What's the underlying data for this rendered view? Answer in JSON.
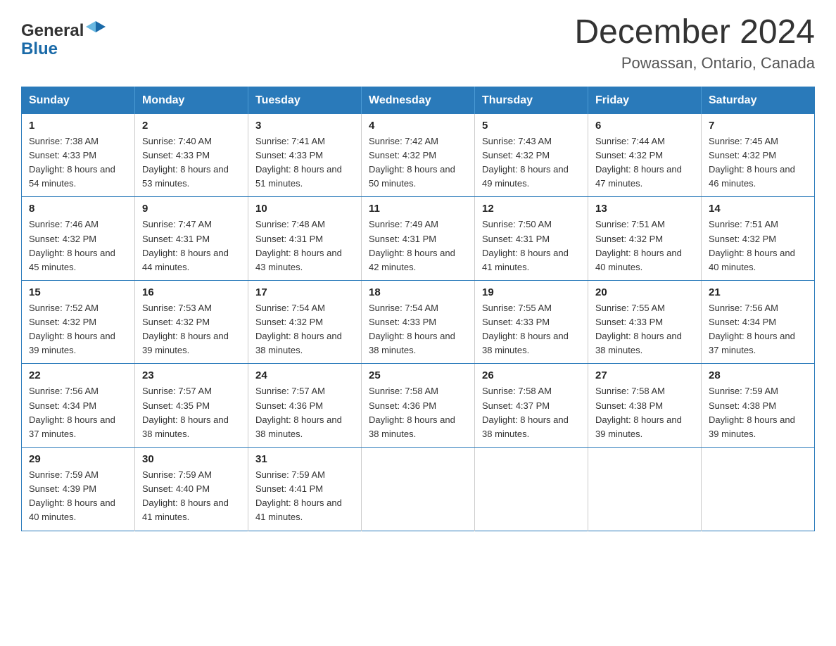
{
  "header": {
    "title": "December 2024",
    "subtitle": "Powassan, Ontario, Canada",
    "logo_general": "General",
    "logo_blue": "Blue"
  },
  "calendar": {
    "days_of_week": [
      "Sunday",
      "Monday",
      "Tuesday",
      "Wednesday",
      "Thursday",
      "Friday",
      "Saturday"
    ],
    "weeks": [
      [
        {
          "day": "1",
          "sunrise": "7:38 AM",
          "sunset": "4:33 PM",
          "daylight": "8 hours and 54 minutes."
        },
        {
          "day": "2",
          "sunrise": "7:40 AM",
          "sunset": "4:33 PM",
          "daylight": "8 hours and 53 minutes."
        },
        {
          "day": "3",
          "sunrise": "7:41 AM",
          "sunset": "4:33 PM",
          "daylight": "8 hours and 51 minutes."
        },
        {
          "day": "4",
          "sunrise": "7:42 AM",
          "sunset": "4:32 PM",
          "daylight": "8 hours and 50 minutes."
        },
        {
          "day": "5",
          "sunrise": "7:43 AM",
          "sunset": "4:32 PM",
          "daylight": "8 hours and 49 minutes."
        },
        {
          "day": "6",
          "sunrise": "7:44 AM",
          "sunset": "4:32 PM",
          "daylight": "8 hours and 47 minutes."
        },
        {
          "day": "7",
          "sunrise": "7:45 AM",
          "sunset": "4:32 PM",
          "daylight": "8 hours and 46 minutes."
        }
      ],
      [
        {
          "day": "8",
          "sunrise": "7:46 AM",
          "sunset": "4:32 PM",
          "daylight": "8 hours and 45 minutes."
        },
        {
          "day": "9",
          "sunrise": "7:47 AM",
          "sunset": "4:31 PM",
          "daylight": "8 hours and 44 minutes."
        },
        {
          "day": "10",
          "sunrise": "7:48 AM",
          "sunset": "4:31 PM",
          "daylight": "8 hours and 43 minutes."
        },
        {
          "day": "11",
          "sunrise": "7:49 AM",
          "sunset": "4:31 PM",
          "daylight": "8 hours and 42 minutes."
        },
        {
          "day": "12",
          "sunrise": "7:50 AM",
          "sunset": "4:31 PM",
          "daylight": "8 hours and 41 minutes."
        },
        {
          "day": "13",
          "sunrise": "7:51 AM",
          "sunset": "4:32 PM",
          "daylight": "8 hours and 40 minutes."
        },
        {
          "day": "14",
          "sunrise": "7:51 AM",
          "sunset": "4:32 PM",
          "daylight": "8 hours and 40 minutes."
        }
      ],
      [
        {
          "day": "15",
          "sunrise": "7:52 AM",
          "sunset": "4:32 PM",
          "daylight": "8 hours and 39 minutes."
        },
        {
          "day": "16",
          "sunrise": "7:53 AM",
          "sunset": "4:32 PM",
          "daylight": "8 hours and 39 minutes."
        },
        {
          "day": "17",
          "sunrise": "7:54 AM",
          "sunset": "4:32 PM",
          "daylight": "8 hours and 38 minutes."
        },
        {
          "day": "18",
          "sunrise": "7:54 AM",
          "sunset": "4:33 PM",
          "daylight": "8 hours and 38 minutes."
        },
        {
          "day": "19",
          "sunrise": "7:55 AM",
          "sunset": "4:33 PM",
          "daylight": "8 hours and 38 minutes."
        },
        {
          "day": "20",
          "sunrise": "7:55 AM",
          "sunset": "4:33 PM",
          "daylight": "8 hours and 38 minutes."
        },
        {
          "day": "21",
          "sunrise": "7:56 AM",
          "sunset": "4:34 PM",
          "daylight": "8 hours and 37 minutes."
        }
      ],
      [
        {
          "day": "22",
          "sunrise": "7:56 AM",
          "sunset": "4:34 PM",
          "daylight": "8 hours and 37 minutes."
        },
        {
          "day": "23",
          "sunrise": "7:57 AM",
          "sunset": "4:35 PM",
          "daylight": "8 hours and 38 minutes."
        },
        {
          "day": "24",
          "sunrise": "7:57 AM",
          "sunset": "4:36 PM",
          "daylight": "8 hours and 38 minutes."
        },
        {
          "day": "25",
          "sunrise": "7:58 AM",
          "sunset": "4:36 PM",
          "daylight": "8 hours and 38 minutes."
        },
        {
          "day": "26",
          "sunrise": "7:58 AM",
          "sunset": "4:37 PM",
          "daylight": "8 hours and 38 minutes."
        },
        {
          "day": "27",
          "sunrise": "7:58 AM",
          "sunset": "4:38 PM",
          "daylight": "8 hours and 39 minutes."
        },
        {
          "day": "28",
          "sunrise": "7:59 AM",
          "sunset": "4:38 PM",
          "daylight": "8 hours and 39 minutes."
        }
      ],
      [
        {
          "day": "29",
          "sunrise": "7:59 AM",
          "sunset": "4:39 PM",
          "daylight": "8 hours and 40 minutes."
        },
        {
          "day": "30",
          "sunrise": "7:59 AM",
          "sunset": "4:40 PM",
          "daylight": "8 hours and 41 minutes."
        },
        {
          "day": "31",
          "sunrise": "7:59 AM",
          "sunset": "4:41 PM",
          "daylight": "8 hours and 41 minutes."
        },
        null,
        null,
        null,
        null
      ]
    ]
  }
}
